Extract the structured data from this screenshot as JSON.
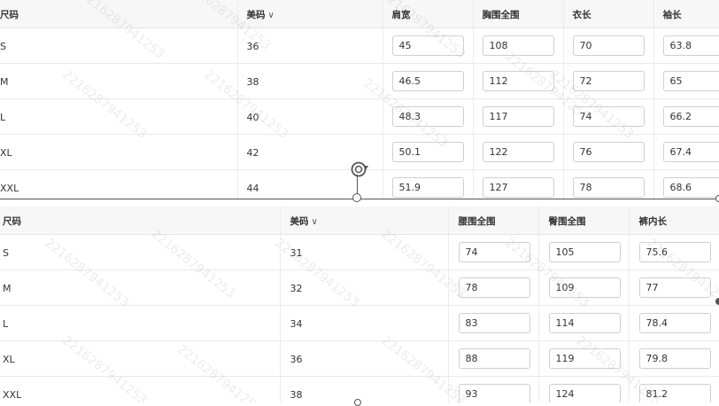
{
  "top_table": {
    "headers": {
      "size": "尺码",
      "us_size": "美码",
      "shoulder": "肩宽",
      "chest": "胸围全围",
      "length": "衣长",
      "sleeve": "袖长"
    },
    "rows": [
      {
        "size": "S",
        "us": "36",
        "shoulder": "45",
        "chest": "108",
        "length": "70",
        "sleeve": "63.8"
      },
      {
        "size": "M",
        "us": "38",
        "shoulder": "46.5",
        "chest": "112",
        "length": "72",
        "sleeve": "65"
      },
      {
        "size": "L",
        "us": "40",
        "shoulder": "48.3",
        "chest": "117",
        "length": "74",
        "sleeve": "66.2"
      },
      {
        "size": "XL",
        "us": "42",
        "shoulder": "50.1",
        "chest": "122",
        "length": "76",
        "sleeve": "67.4"
      },
      {
        "size": "XXL",
        "us": "44",
        "shoulder": "51.9",
        "chest": "127",
        "length": "78",
        "sleeve": "68.6"
      }
    ]
  },
  "bottom_table": {
    "headers": {
      "size": "尺码",
      "us_size": "美码",
      "waist": "腰围全围",
      "hip": "臀围全围",
      "inseam": "裤内长"
    },
    "rows": [
      {
        "size": "S",
        "us": "31",
        "waist": "74",
        "hip": "105",
        "inseam": "75.6"
      },
      {
        "size": "M",
        "us": "32",
        "waist": "78",
        "hip": "109",
        "inseam": "77"
      },
      {
        "size": "L",
        "us": "34",
        "waist": "83",
        "hip": "114",
        "inseam": "78.4"
      },
      {
        "size": "XL",
        "us": "36",
        "waist": "88",
        "hip": "119",
        "inseam": "79.8"
      },
      {
        "size": "XXL",
        "us": "38",
        "waist": "93",
        "hip": "124",
        "inseam": "81.2"
      }
    ]
  },
  "icons": {
    "sort": "chevron-down-icon",
    "rotate": "rotate-icon"
  },
  "watermark": "2216287941253"
}
